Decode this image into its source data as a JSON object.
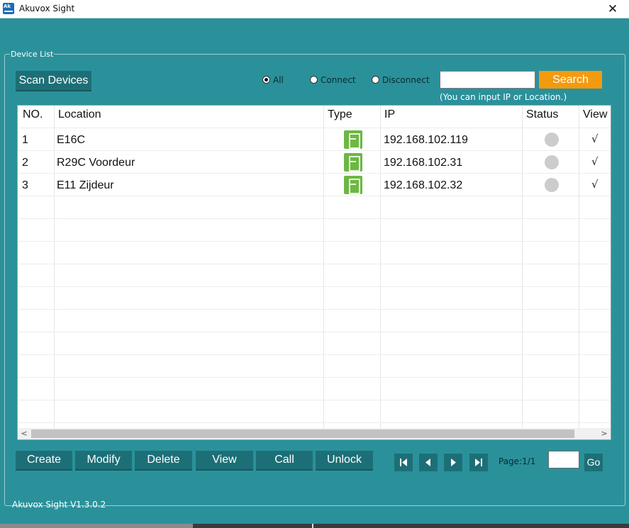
{
  "window": {
    "title": "Akuvox Sight",
    "app_icon": "akuvox-app-icon",
    "close_glyph": "✕"
  },
  "device_list": {
    "legend": "Device List",
    "scan_button": "Scan Devices",
    "filters": [
      {
        "label": "All",
        "selected": true
      },
      {
        "label": "Connect",
        "selected": false
      },
      {
        "label": "Disconnect",
        "selected": false
      }
    ],
    "search": {
      "value": "",
      "button": "Search",
      "hint": "(You can input IP or Location.)"
    },
    "columns": {
      "no": "NO.",
      "location": "Location",
      "type": "Type",
      "ip": "IP",
      "status": "Status",
      "view": "View"
    },
    "rows": [
      {
        "no": "1",
        "location": "E16C",
        "type_icon": "door-phone-icon",
        "ip": "192.168.102.119",
        "status": "offline",
        "view": "√"
      },
      {
        "no": "2",
        "location": "R29C Voordeur",
        "type_icon": "door-phone-icon",
        "ip": "192.168.102.31",
        "status": "offline",
        "view": "√"
      },
      {
        "no": "3",
        "location": "E11 Zijdeur",
        "type_icon": "door-phone-icon",
        "ip": "192.168.102.32",
        "status": "offline",
        "view": "√"
      }
    ]
  },
  "actions": {
    "create": "Create",
    "modify": "Modify",
    "delete": "Delete",
    "view": "View",
    "call": "Call",
    "unlock": "Unlock"
  },
  "pagination": {
    "label": "Page:1/1",
    "page_input": "",
    "go": "Go"
  },
  "footer": {
    "version": "Akuvox Sight V1.3.0.2"
  },
  "colors": {
    "background": "#2a919b",
    "button": "#1d6f77",
    "search_button": "#f39a0f",
    "type_icon": "#6cb843",
    "status_offline": "#cccccc"
  }
}
